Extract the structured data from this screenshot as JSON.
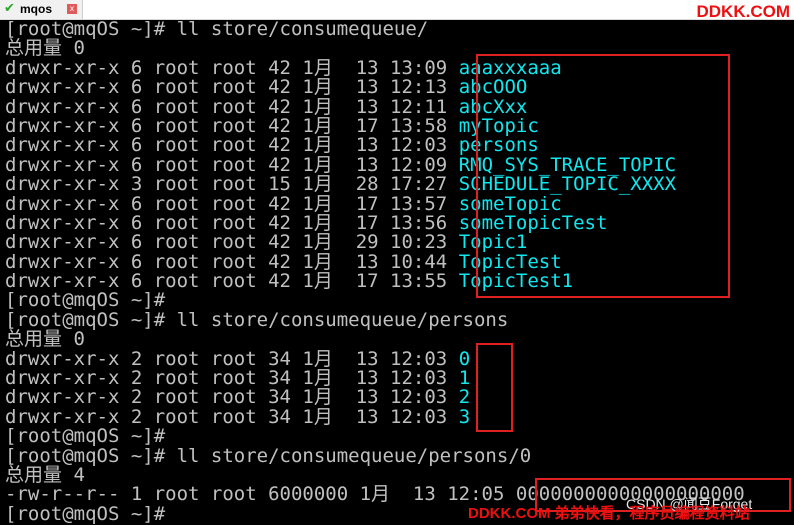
{
  "tab": {
    "title": "mqos",
    "close_glyph": "x",
    "check_icon": "check-icon"
  },
  "watermarks": {
    "top": "DDKK.COM",
    "csdn": "CSDN @闻豆Forget",
    "bottom": "DDKK.COM 弟弟快看，程序员编程资料站"
  },
  "colors": {
    "background": "#000000",
    "text": "#c0c0c0",
    "dir": "#10e8f0",
    "highlight_box": "#e02020"
  },
  "lines": [
    {
      "text": "[root@mqOS ~]# ll store/consumequeue/",
      "name": ""
    },
    {
      "text": "总用量 0",
      "name": ""
    },
    {
      "text": "drwxr-xr-x 6 root root 42 1月  13 13:09 ",
      "name": "aaaxxxaaa"
    },
    {
      "text": "drwxr-xr-x 6 root root 42 1月  13 12:13 ",
      "name": "abcOOO"
    },
    {
      "text": "drwxr-xr-x 6 root root 42 1月  13 12:11 ",
      "name": "abcXxx"
    },
    {
      "text": "drwxr-xr-x 6 root root 42 1月  17 13:58 ",
      "name": "myTopic"
    },
    {
      "text": "drwxr-xr-x 6 root root 42 1月  13 12:03 ",
      "name": "persons"
    },
    {
      "text": "drwxr-xr-x 6 root root 42 1月  13 12:09 ",
      "name": "RMQ_SYS_TRACE_TOPIC"
    },
    {
      "text": "drwxr-xr-x 3 root root 15 1月  28 17:27 ",
      "name": "SCHEDULE_TOPIC_XXXX"
    },
    {
      "text": "drwxr-xr-x 6 root root 42 1月  17 13:57 ",
      "name": "someTopic"
    },
    {
      "text": "drwxr-xr-x 6 root root 42 1月  17 13:56 ",
      "name": "someTopicTest"
    },
    {
      "text": "drwxr-xr-x 6 root root 42 1月  29 10:23 ",
      "name": "Topic1"
    },
    {
      "text": "drwxr-xr-x 6 root root 42 1月  13 10:44 ",
      "name": "TopicTest"
    },
    {
      "text": "drwxr-xr-x 6 root root 42 1月  17 13:55 ",
      "name": "TopicTest1"
    },
    {
      "text": "[root@mqOS ~]#",
      "name": ""
    },
    {
      "text": "[root@mqOS ~]# ll store/consumequeue/persons",
      "name": ""
    },
    {
      "text": "总用量 0",
      "name": ""
    },
    {
      "text": "drwxr-xr-x 2 root root 34 1月  13 12:03 ",
      "name": "0"
    },
    {
      "text": "drwxr-xr-x 2 root root 34 1月  13 12:03 ",
      "name": "1"
    },
    {
      "text": "drwxr-xr-x 2 root root 34 1月  13 12:03 ",
      "name": "2"
    },
    {
      "text": "drwxr-xr-x 2 root root 34 1月  13 12:03 ",
      "name": "3"
    },
    {
      "text": "[root@mqOS ~]#",
      "name": ""
    },
    {
      "text": "[root@mqOS ~]# ll store/consumequeue/persons/0",
      "name": ""
    },
    {
      "text": "总用量 4",
      "name": ""
    },
    {
      "text": "-rw-r--r-- 1 root root 6000000 1月  13 12:05 ",
      "name": "00000000000000000000"
    },
    {
      "text": "[root@mqOS ~]#",
      "name": ""
    }
  ]
}
